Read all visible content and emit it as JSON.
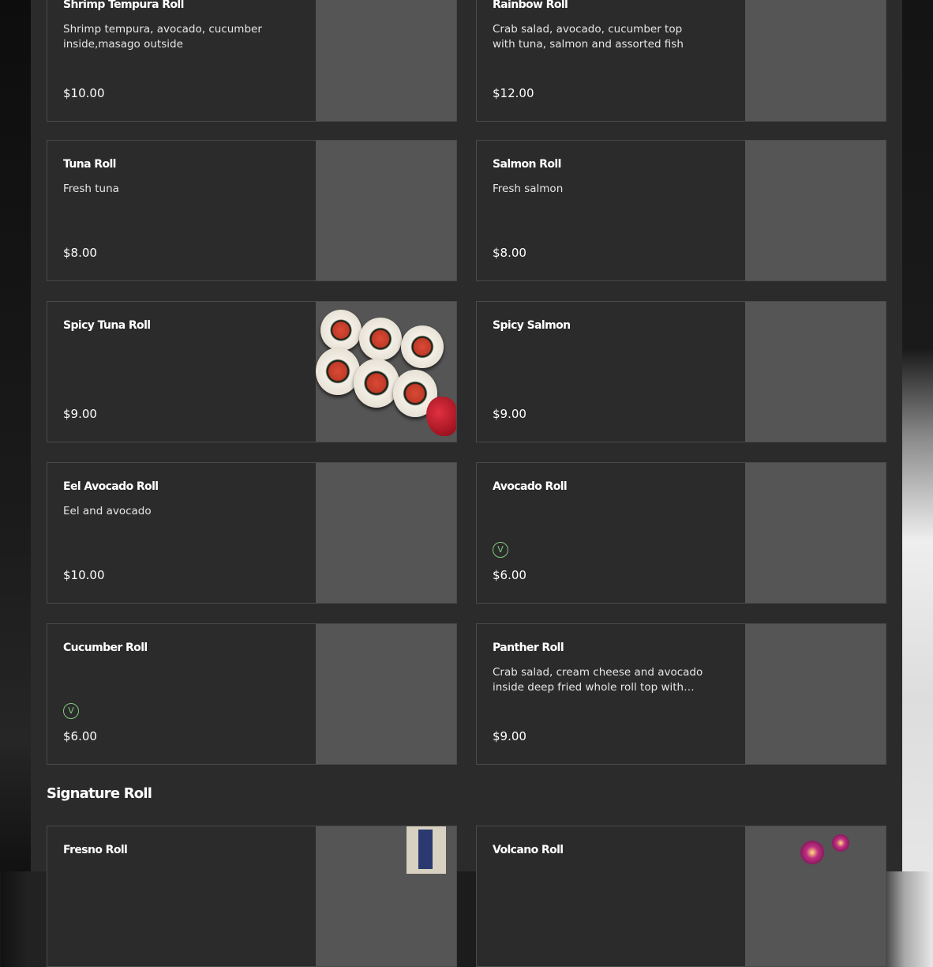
{
  "menu": {
    "items": [
      {
        "title": "Shrimp Tempura Roll",
        "desc": "Shrimp tempura, avocado, cucumber inside,masago outside",
        "price": "$10.00"
      },
      {
        "title": "Rainbow Roll",
        "desc": "Crab salad, avocado, cucumber top with tuna, salmon and assorted fish",
        "price": "$12.00"
      },
      {
        "title": "Tuna Roll",
        "desc": "Fresh tuna",
        "price": "$8.00"
      },
      {
        "title": "Salmon Roll",
        "desc": "Fresh salmon",
        "price": "$8.00"
      },
      {
        "title": "Spicy Tuna Roll",
        "desc": "",
        "price": "$9.00"
      },
      {
        "title": "Spicy Salmon",
        "desc": "",
        "price": "$9.00"
      },
      {
        "title": "Eel Avocado Roll",
        "desc": "Eel and avocado",
        "price": "$10.00"
      },
      {
        "title": "Avocado Roll",
        "desc": "",
        "price": "$6.00",
        "veg_badge": "V"
      },
      {
        "title": "Cucumber Roll",
        "desc": "",
        "price": "$6.00",
        "veg_badge": "V"
      },
      {
        "title": "Panther Roll",
        "desc": "Crab salad, cream cheese and avocado inside deep fried whole roll top with eel…",
        "price": "$9.00"
      }
    ],
    "signature": {
      "heading": "Signature Roll",
      "items": [
        {
          "title": "Fresno Roll"
        },
        {
          "title": "Volcano Roll"
        }
      ]
    }
  },
  "colors": {
    "panel": "#2b2b2b",
    "card_border": "#4a4a4a",
    "image_placeholder": "#555555",
    "veg_badge": "#7ec87e"
  }
}
